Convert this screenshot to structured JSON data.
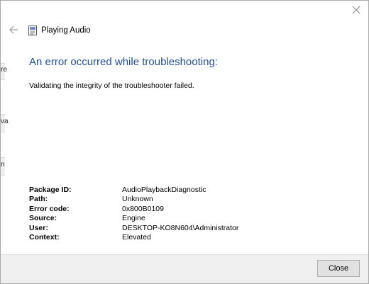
{
  "window": {
    "title": "Playing Audio"
  },
  "background_fragments": {
    "a": "re",
    "b": "va",
    "c": "n"
  },
  "error": {
    "heading": "An error occurred while troubleshooting:",
    "message": "Validating the integrity of the troubleshooter failed."
  },
  "details": [
    {
      "label": "Package ID:",
      "value": "AudioPlaybackDiagnostic"
    },
    {
      "label": "Path:",
      "value": "Unknown"
    },
    {
      "label": "Error code:",
      "value": "0x800B0109"
    },
    {
      "label": "Source:",
      "value": "Engine"
    },
    {
      "label": "User:",
      "value": "DESKTOP-KO8N604\\Administrator"
    },
    {
      "label": "Context:",
      "value": "Elevated"
    }
  ],
  "footer": {
    "close_label": "Close"
  },
  "icons": {
    "back": "back-arrow-icon",
    "close": "close-icon",
    "app": "troubleshooter-app-icon"
  },
  "colors": {
    "heading": "#1f4e9c",
    "footer_bg": "#f0f0f0",
    "button_bg": "#e1e1e1"
  }
}
